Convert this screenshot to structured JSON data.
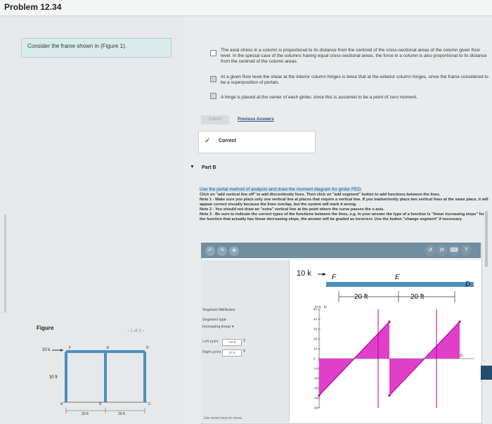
{
  "header": {
    "title": "Problem 12.34"
  },
  "prompt": {
    "text": "Consider the frame shown in (Figure 1)."
  },
  "options": [
    {
      "text": "The axial stress in a column is proportional to its distance from the centroid of the cross-sectional areas of the column given floor level. In the special case of the columns having equal cross-sectional areas, the force in a column is also proportional to its distance from the centroid of the column areas.",
      "checked": false
    },
    {
      "text": "At a given floor level the shear at the interior column hinges is twice that at the exterior column hinges, since the frame considered to be a superposition of portals.",
      "checked": true
    },
    {
      "text": "A hinge is placed at the center of each girder, since this is assumed to be a point of zero moment.",
      "checked": true
    }
  ],
  "submit_label": "Submit",
  "previous_answers_label": "Previous Answers",
  "feedback": {
    "status": "Correct"
  },
  "partb": {
    "label": "Part B",
    "highlight": "Use the portal method of analysis and draw the moment diagram for girder FED.",
    "instructions": "Click on \"add vertical line off\" to add discontinuity lines. Then click on \"add segment\" button to add functions between the lines.\nNote 1 - Make sure you place only one vertical line at places that require a vertical line. If you inadvertently place two vertical lines at the same place, it will appear correct visually because the lines overlap, but the system will mark it wrong.\nNote 2 - You should not draw an \"extra\" vertical line at the point where the curve passes the x-axis.\nNote 3 - Be sure to indicate the correct types of the functions between the lines, e.g. in your answer the type of a function is \"linear increasing slope\" for the function that actually has linear decreasing slope, the answer will be graded as incorrect. Use the button \"change segment\" if necessary."
  },
  "tool": {
    "segment_attributes": "Segment Attributes",
    "segment_type_label": "Segment type",
    "segment_type_value": "Increasing linear",
    "left_point_label": "Left point",
    "left_point_value": "-37.5",
    "right_point_label": "Right point",
    "right_point_value": "37.5"
  },
  "beam": {
    "load": "10 k",
    "node_f": "F",
    "node_e": "E",
    "node_d": "D",
    "span1": "20 ft",
    "span2": "20 ft"
  },
  "plot": {
    "ylabel": "M (k · ft)",
    "yticks": [
      "50",
      "40",
      "30",
      "20",
      "10",
      "0",
      "-10",
      "-20",
      "-30",
      "-40",
      "-50"
    ],
    "xlabel": "x (ft)",
    "colors": {
      "fill": "#e040c8",
      "line": "#b000a0"
    },
    "chart_data": {
      "type": "line",
      "series": [
        {
          "x": [
            0,
            20
          ],
          "y": [
            -37.5,
            37.5
          ]
        },
        {
          "x": [
            20,
            40
          ],
          "y": [
            -37.5,
            37.5
          ]
        }
      ],
      "ylim": [
        -50,
        50
      ]
    }
  },
  "figure": {
    "label": "Figure",
    "pager": "1 of 1",
    "load": "10 k",
    "height": "30 ft",
    "span1": "20 ft",
    "span2": "20 ft",
    "nodes": [
      "F",
      "E",
      "D",
      "A",
      "B",
      "C"
    ]
  },
  "bottom_fragment": "Use arrow keys to move..."
}
